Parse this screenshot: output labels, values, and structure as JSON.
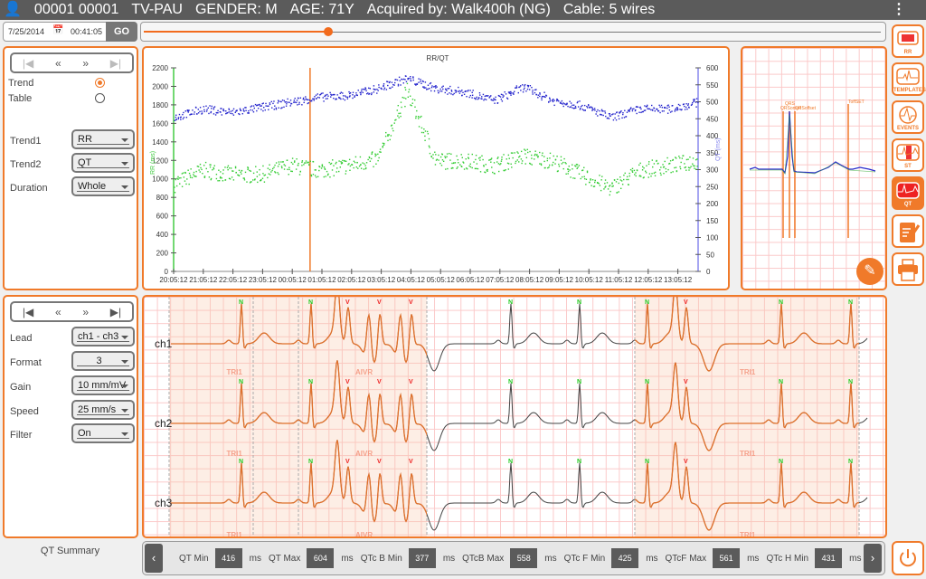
{
  "header": {
    "patient_icon": "user-icon",
    "id": "00001 00001",
    "name": "TV-PAU",
    "gender": "GENDER: M",
    "age": "AGE: 71Y",
    "acquired": "Acquired by: Walk400h (NG)",
    "cable": "Cable: 5 wires",
    "menu_icon": "kebab-menu-icon"
  },
  "toolbar": {
    "date": "7/25/2014",
    "time": "00:41:05",
    "go_label": "GO",
    "slider_position": 0.25,
    "accent": "#f26b1d"
  },
  "trend_panel": {
    "nav": [
      "first",
      "prev-page",
      "next-page",
      "last"
    ],
    "view_options": [
      {
        "label": "Trend",
        "selected": true
      },
      {
        "label": "Table",
        "selected": false
      }
    ],
    "fields": [
      {
        "label": "Trend1",
        "value": "RR"
      },
      {
        "label": "Trend2",
        "value": "QT"
      },
      {
        "label": "Duration",
        "value": "Whole"
      }
    ]
  },
  "chart_data": {
    "type": "scatter",
    "title": "RR/QT",
    "ylabel": "RR (ms)",
    "y2label": "QT (ms)",
    "x_ticks": [
      "20:05:12",
      "21:05:12",
      "22:05:12",
      "23:05:12",
      "00:05:12",
      "01:05:12",
      "02:05:12",
      "03:05:12",
      "04:05:12",
      "05:05:12",
      "06:05:12",
      "07:05:12",
      "08:05:12",
      "09:05:12",
      "10:05:12",
      "11:05:12",
      "12:05:12",
      "13:05:12"
    ],
    "ylim": [
      0,
      2200
    ],
    "y_ticks": [
      0,
      200,
      400,
      600,
      800,
      1000,
      1200,
      1400,
      1600,
      1800,
      2000,
      2200
    ],
    "y2lim": [
      0,
      600
    ],
    "y2_ticks": [
      0,
      50,
      100,
      150,
      200,
      250,
      300,
      350,
      400,
      450,
      500,
      550,
      600
    ],
    "cursor": "00:41:05",
    "series": [
      {
        "name": "RR",
        "axis": "left",
        "color": "#33cc33",
        "values": [
          950,
          1100,
          1050,
          1050,
          1150,
          1100,
          1150,
          1220,
          1950,
          1200,
          1200,
          1150,
          1250,
          1200,
          1050,
          900,
          1100,
          1150,
          1200
        ]
      },
      {
        "name": "QT",
        "axis": "right",
        "color": "#2222cc",
        "values": [
          455,
          480,
          470,
          485,
          500,
          515,
          520,
          540,
          570,
          540,
          530,
          505,
          545,
          505,
          490,
          455,
          480,
          480,
          500
        ]
      }
    ]
  },
  "template_panel": {
    "markers": [
      "QRS",
      "QRSonset",
      "QRSoffset",
      "ToffSET"
    ],
    "edit_icon": "pencil-icon"
  },
  "side_buttons": [
    {
      "label": "RR",
      "icon": "rr-icon"
    },
    {
      "label": "TEMPLATES",
      "icon": "templates-icon"
    },
    {
      "label": "EVENTS",
      "icon": "events-icon"
    },
    {
      "label": "ST",
      "icon": "st-icon"
    },
    {
      "label": "QT",
      "icon": "qt-icon",
      "active": true
    },
    {
      "label": "",
      "icon": "edit-report-icon"
    },
    {
      "label": "",
      "icon": "print-icon"
    }
  ],
  "ecg_panel": {
    "nav": [
      "first",
      "prev-page",
      "next-page",
      "last"
    ],
    "fields": [
      {
        "label": "Lead",
        "value": "ch1 - ch3"
      },
      {
        "label": "Format",
        "value": "3"
      },
      {
        "label": "Gain",
        "value": "10 mm/mV"
      },
      {
        "label": "Speed",
        "value": "25 mm/s"
      },
      {
        "label": "Filter",
        "value": "On"
      }
    ],
    "channels": [
      "ch1",
      "ch2",
      "ch3"
    ],
    "events": [
      {
        "label": "TRI1"
      },
      {
        "label": "AIVR"
      },
      {
        "label": "TRI1"
      }
    ],
    "beats": [
      "N",
      "N",
      "V",
      "V",
      "V",
      "N",
      "N",
      "N",
      "V",
      "N",
      "N"
    ]
  },
  "summary": {
    "title": "QT Summary",
    "items": [
      {
        "label": "QT Min",
        "value": "416",
        "unit": "ms"
      },
      {
        "label": "QT Max",
        "value": "604",
        "unit": "ms"
      },
      {
        "label": "QTc B Min",
        "value": "377",
        "unit": "ms"
      },
      {
        "label": "QTcB Max",
        "value": "558",
        "unit": "ms"
      },
      {
        "label": "QTc F Min",
        "value": "425",
        "unit": "ms"
      },
      {
        "label": "QTcF Max",
        "value": "561",
        "unit": "ms"
      },
      {
        "label": "QTc H Min",
        "value": "431",
        "unit": "ms"
      }
    ],
    "prev_icon": "chevron-left-icon",
    "next_icon": "chevron-right-icon",
    "power_icon": "power-icon"
  }
}
